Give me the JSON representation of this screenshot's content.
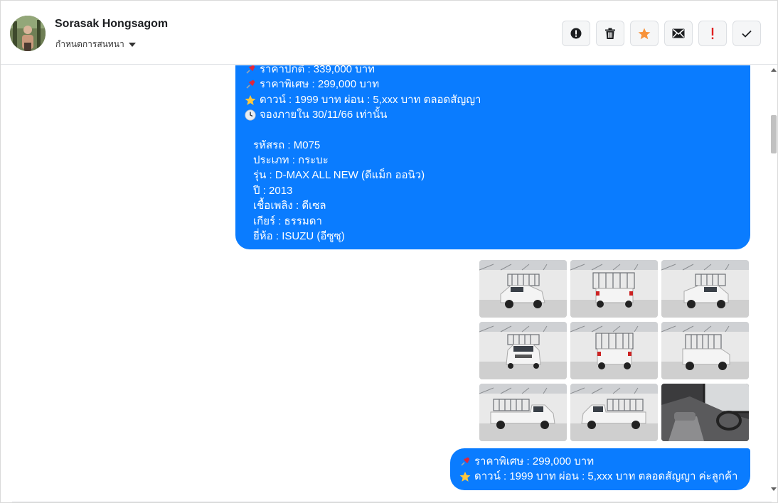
{
  "header": {
    "contact_name": "Sorasak Hongsagom",
    "settings_label": "กำหนดการสนทนา",
    "actions": [
      {
        "name": "report-button",
        "icon": "alert-circle-icon"
      },
      {
        "name": "delete-button",
        "icon": "trash-icon"
      },
      {
        "name": "star-button",
        "icon": "star-icon"
      },
      {
        "name": "mark-unread-button",
        "icon": "envelope-icon"
      },
      {
        "name": "important-button",
        "icon": "exclamation-icon"
      },
      {
        "name": "mark-done-button",
        "icon": "checkmark-icon"
      }
    ]
  },
  "colors": {
    "bubble": "#0a7cff",
    "star": "#f7923a",
    "important": "#e02020"
  },
  "message1": {
    "price_normal": "ราคาปกติ : 339,000 บาท",
    "price_special": "ราคาพิเศษ : 299,000 บาท",
    "down_payment": "ดาวน์ : 1999 บาท ผ่อน : 5,xxx บาท ตลอดสัญญา",
    "deadline": "จองภายใน 30/11/66 เท่านั้น",
    "code": "รหัสรถ : M075",
    "type": "ประเภท : กระบะ",
    "model": "รุ่น : D-MAX ALL NEW (ดีแม็ก ออนิว)",
    "year": "ปี : 2013",
    "fuel": "เชื้อเพลิง : ดีเซล",
    "gear": "เกียร์ : ธรรมดา",
    "brand": "ยี่ห้อ : ISUZU (อีซูซุ)"
  },
  "gallery": {
    "photos": [
      "white-pickup-front-left",
      "white-pickup-rear",
      "white-pickup-front-right",
      "white-pickup-front",
      "white-pickup-rear-center",
      "white-pickup-rear-right",
      "white-pickup-side-left",
      "white-pickup-side-right",
      "pickup-interior-dashboard"
    ]
  },
  "message2": {
    "price_special": "ราคาพิเศษ : 299,000 บาท",
    "down_payment": "ดาวน์ : 1999 บาท ผ่อน : 5,xxx บาท ตลอดสัญญา ค่ะลูกค้า"
  }
}
